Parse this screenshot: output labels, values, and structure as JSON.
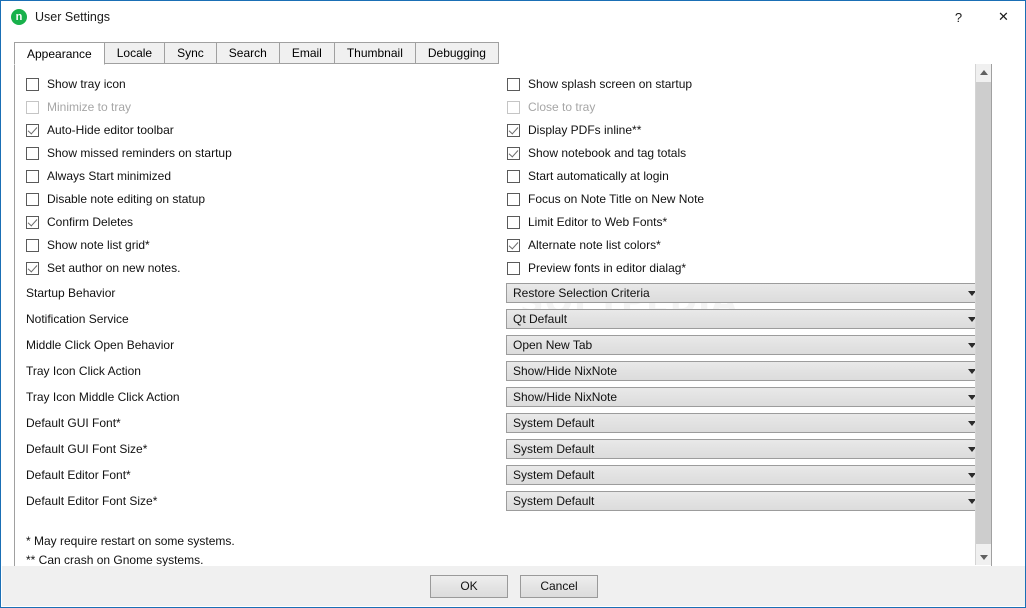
{
  "window": {
    "title": "User Settings",
    "app_icon": "nixnote-icon",
    "app_icon_glyph": "n",
    "accent_color": "#18b14b",
    "border_color": "#1a6fb5",
    "help_label": "?",
    "close_label": "✕"
  },
  "tabs": [
    {
      "label": "Appearance",
      "active": true
    },
    {
      "label": "Locale",
      "active": false
    },
    {
      "label": "Sync",
      "active": false
    },
    {
      "label": "Search",
      "active": false
    },
    {
      "label": "Email",
      "active": false
    },
    {
      "label": "Thumbnail",
      "active": false
    },
    {
      "label": "Debugging",
      "active": false
    }
  ],
  "checkboxes_left": [
    {
      "label": "Show tray icon",
      "checked": false,
      "disabled": false
    },
    {
      "label": "Minimize to tray",
      "checked": false,
      "disabled": true
    },
    {
      "label": "Auto-Hide editor toolbar",
      "checked": true,
      "disabled": false
    },
    {
      "label": "Show missed reminders on startup",
      "checked": false,
      "disabled": false
    },
    {
      "label": "Always Start minimized",
      "checked": false,
      "disabled": false
    },
    {
      "label": "Disable note editing on statup",
      "checked": false,
      "disabled": false
    },
    {
      "label": "Confirm Deletes",
      "checked": true,
      "disabled": false
    },
    {
      "label": "Show note list grid*",
      "checked": false,
      "disabled": false
    },
    {
      "label": "Set author on new notes.",
      "checked": true,
      "disabled": false
    }
  ],
  "checkboxes_right": [
    {
      "label": "Show splash screen on startup",
      "checked": false,
      "disabled": false
    },
    {
      "label": "Close to tray",
      "checked": false,
      "disabled": true
    },
    {
      "label": "Display PDFs inline**",
      "checked": true,
      "disabled": false
    },
    {
      "label": "Show notebook and tag totals",
      "checked": true,
      "disabled": false
    },
    {
      "label": "Start automatically at login",
      "checked": false,
      "disabled": false
    },
    {
      "label": "Focus on Note Title on New Note",
      "checked": false,
      "disabled": false
    },
    {
      "label": "Limit Editor to Web Fonts*",
      "checked": false,
      "disabled": false
    },
    {
      "label": "Alternate note list colors*",
      "checked": true,
      "disabled": false
    },
    {
      "label": "Preview fonts in editor dialag*",
      "checked": false,
      "disabled": false
    }
  ],
  "settings_rows": [
    {
      "label": "Startup Behavior",
      "value": "Restore Selection Criteria"
    },
    {
      "label": "Notification Service",
      "value": "Qt Default"
    },
    {
      "label": "Middle Click Open Behavior",
      "value": "Open New Tab"
    },
    {
      "label": "Tray Icon Click Action",
      "value": "Show/Hide NixNote"
    },
    {
      "label": "Tray Icon Middle Click Action",
      "value": "Show/Hide NixNote"
    },
    {
      "label": "Default GUI Font*",
      "value": "System Default"
    },
    {
      "label": "Default GUI Font Size*",
      "value": "System Default"
    },
    {
      "label": "Default Editor Font*",
      "value": "System Default"
    },
    {
      "label": "Default Editor Font Size*",
      "value": "System Default"
    }
  ],
  "footnotes": [
    "* May require restart on some systems.",
    "** Can crash on Gnome systems."
  ],
  "watermark": {
    "text": "SOFTPEDIA"
  },
  "scrollbar": {
    "up_icon": "chevron-up-icon",
    "down_icon": "chevron-down-icon"
  },
  "footer": {
    "ok_label": "OK",
    "cancel_label": "Cancel"
  }
}
